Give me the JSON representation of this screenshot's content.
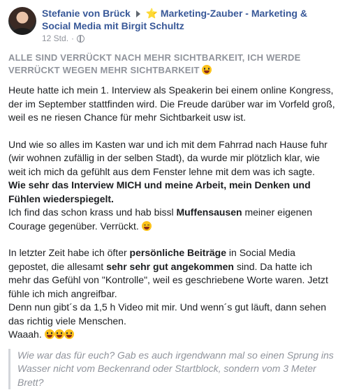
{
  "header": {
    "author": "Stefanie von Brück",
    "group": "⭐ Marketing-Zauber - Marketing & Social Media mit Birgit Schultz",
    "time": "12 Std."
  },
  "post": {
    "title": "ALLE SIND VERRÜCKT NACH MEHR SICHTBARKEIT, ICH WERDE VERRÜCKT WEGEN MEHR SICHTBARKEIT",
    "p1": "Heute hatte ich mein 1. Interview als Speakerin bei einem online Kongress, der im September stattfinden wird. Die Freude darüber war im Vorfeld groß, weil es ne riesen Chance für mehr Sichtbarkeit usw ist.",
    "p2_line1": "Und wie so alles im Kasten war und ich mit dem Fahrrad nach Hause fuhr (wir wohnen zufällig in der selben Stadt), da wurde mir plötzlich klar, wie weit ich mich da gefühlt aus dem Fenster lehne mit dem was ich sagte.",
    "p2_bold": "Wie sehr das Interview MICH und meine Arbeit, mein Denken und Fühlen wiederspiegelt.",
    "p2_line3a": "Ich find das schon krass und hab bissl",
    "p2_line3_bold": "Muffensausen",
    "p2_line3b": "meiner eigenen Courage gegenüber. Verrückt.",
    "p3a": "In letzter Zeit habe ich öfter",
    "p3_bold1": "persönliche Beiträge",
    "p3b": "in Social Media gepostet, die allesamt",
    "p3_bold2": "sehr sehr gut angekommen",
    "p3c": "sind. Da hatte ich mehr das Gefühl von \"Kontrolle\", weil es geschriebene Worte waren. Jetzt fühle ich mich angreifbar.",
    "p3d": "Denn nun gibt´s da 1,5 h Video mit mir. Und wenn´s gut läuft, dann sehen das richtig viele Menschen.",
    "p3e": "Waaah.",
    "quote": "Wie war das für euch? Gab es auch irgendwann mal so einen Sprung ins Wasser nicht vom Beckenrand oder Startblock, sondern vom 3 Meter Brett?"
  }
}
